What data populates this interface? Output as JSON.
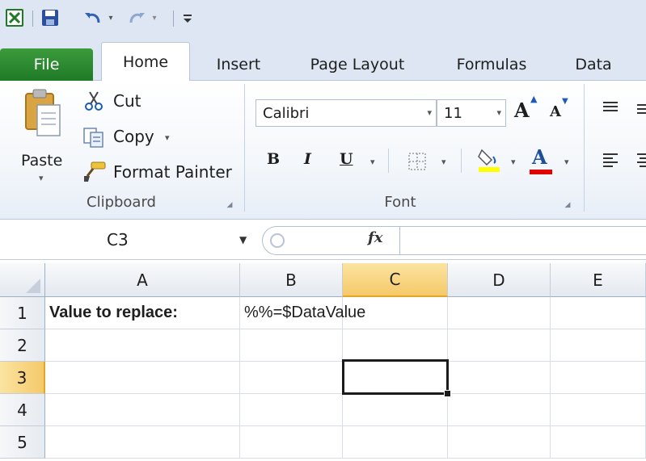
{
  "quick_access": {
    "icons": [
      "excel-icon",
      "save-icon",
      "undo-icon",
      "redo-icon",
      "customize-toolbar-icon"
    ]
  },
  "tabs": [
    {
      "label": "File"
    },
    {
      "label": "Home"
    },
    {
      "label": "Insert"
    },
    {
      "label": "Page Layout"
    },
    {
      "label": "Formulas"
    },
    {
      "label": "Data"
    }
  ],
  "clipboard": {
    "paste_label": "Paste",
    "cut_label": "Cut",
    "copy_label": "Copy",
    "format_painter_label": "Format Painter",
    "group_label": "Clipboard"
  },
  "font": {
    "font_name": "Calibri",
    "font_size": "11",
    "bold_label": "B",
    "italic_label": "I",
    "underline_label": "U",
    "font_color_label": "A",
    "grow_label": "A",
    "shrink_label": "A",
    "group_label": "Font",
    "highlight_color": "#ffff00",
    "font_color": "#e00000"
  },
  "formula_bar": {
    "name_box": "C3",
    "fx_label": "fx",
    "formula": ""
  },
  "grid": {
    "columns": [
      "A",
      "B",
      "C",
      "D",
      "E"
    ],
    "rows": [
      "1",
      "2",
      "3",
      "4",
      "5"
    ],
    "selected_column": "C",
    "selected_row": "3",
    "cells": {
      "A1": "Value to replace:",
      "B1": "%%=$DataValue"
    }
  },
  "colors": {
    "file_tab": "#2a8a30",
    "ribbon_bg": "#dde6f2",
    "selected_header": "#f5c969"
  }
}
